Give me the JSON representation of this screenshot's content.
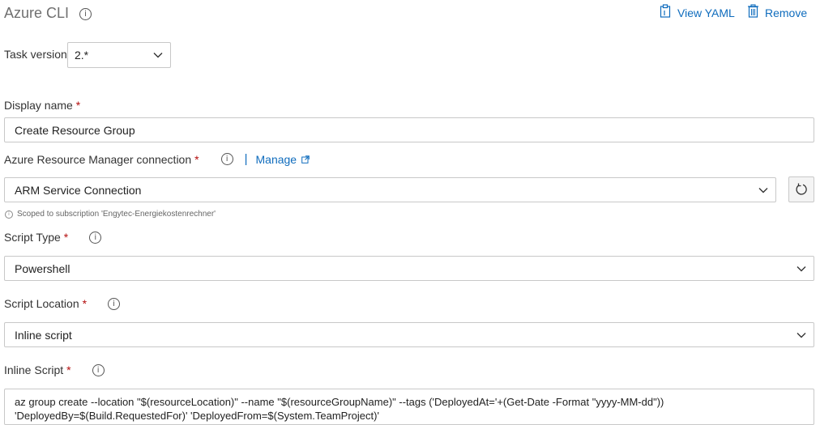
{
  "header": {
    "title": "Azure CLI",
    "view_yaml_label": "View YAML",
    "remove_label": "Remove"
  },
  "task_version": {
    "label": "Task version",
    "value": "2.*"
  },
  "display_name": {
    "label": "Display name",
    "required": "*",
    "value": "Create Resource Group"
  },
  "arm_connection": {
    "label": "Azure Resource Manager connection",
    "required": "*",
    "separator": "|",
    "manage_label": "Manage",
    "value": "ARM Service Connection",
    "hint": "Scoped to subscription 'Engytec-Energiekostenrechner'"
  },
  "script_type": {
    "label": "Script Type",
    "required": "*",
    "value": "Powershell"
  },
  "script_location": {
    "label": "Script Location",
    "required": "*",
    "value": "Inline script"
  },
  "inline_script": {
    "label": "Inline Script",
    "required": "*",
    "lines": [
      "az group create --location \"$(resourceLocation)\" --name \"$(resourceGroupName)\" --tags ('DeployedAt='+(Get-Date -Format \"yyyy-MM-dd\"))",
      "'DeployedBy=$(Build.RequestedFor)' 'DeployedFrom=$(System.TeamProject)'"
    ]
  },
  "icons": {
    "info": "info-icon",
    "view_yaml": "clipboard-icon",
    "remove": "trash-icon",
    "dropdown": "chevron-down-icon",
    "manage": "external-link-icon",
    "refresh": "refresh-icon"
  },
  "colors": {
    "link": "#0f6cbd",
    "required": "#b40e0e",
    "border": "#c8c8c8"
  }
}
